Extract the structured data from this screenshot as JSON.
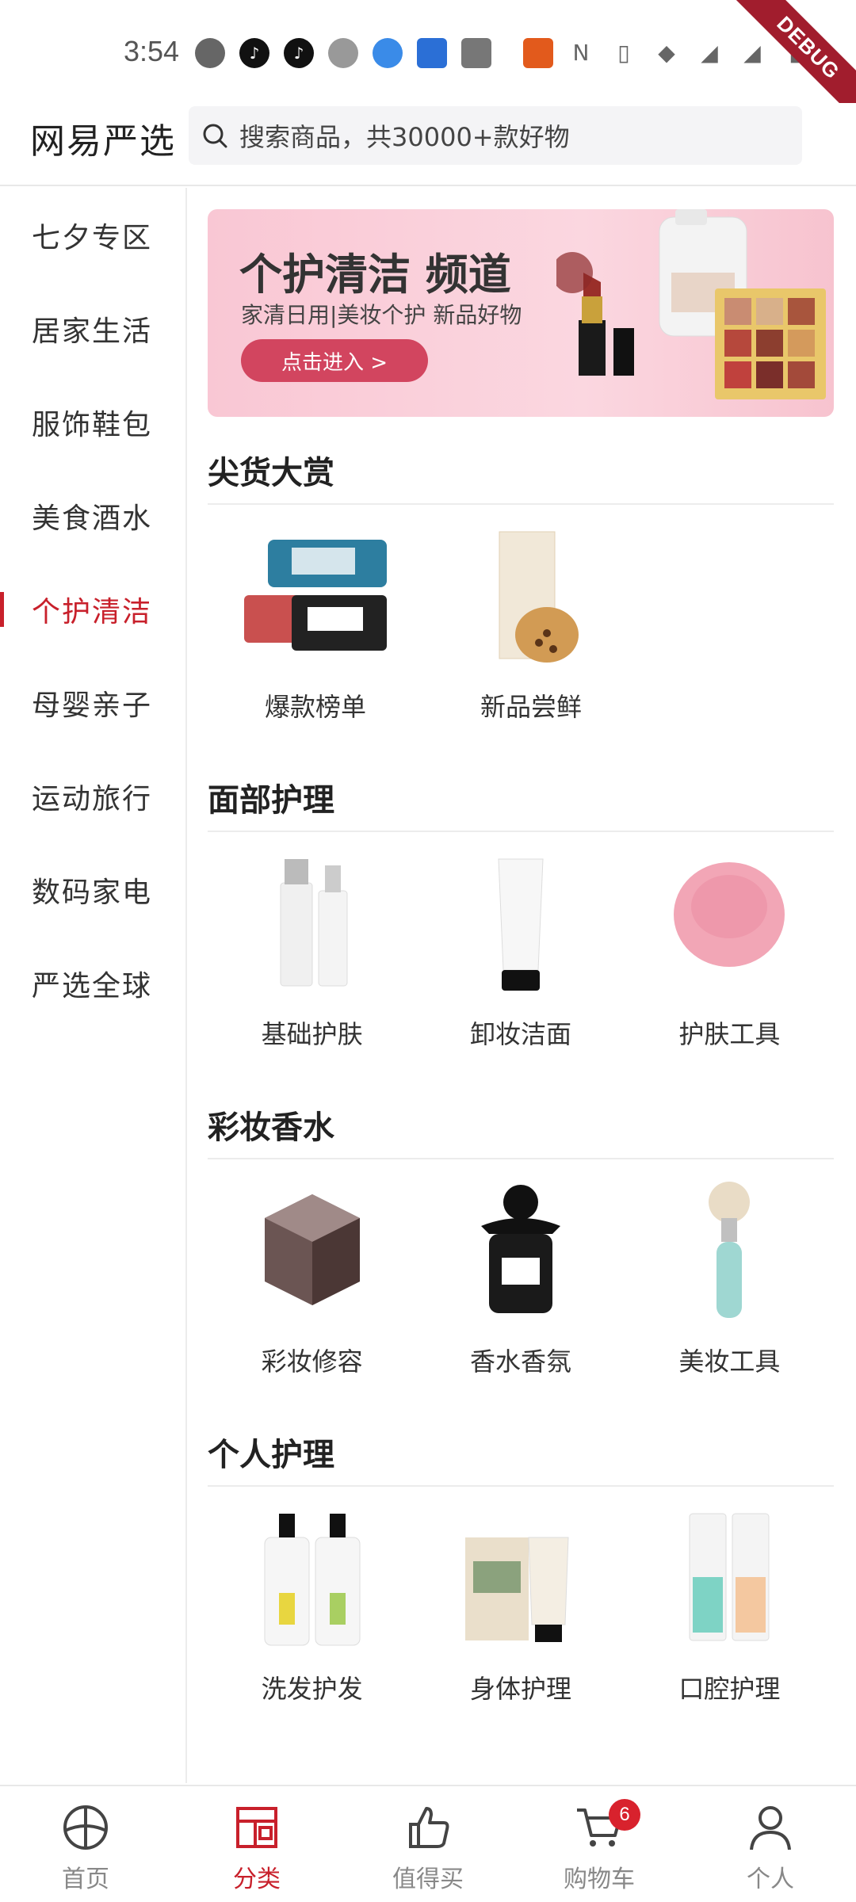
{
  "status_bar": {
    "time": "3:54",
    "debug": "DEBUG"
  },
  "header": {
    "brand": "网易严选",
    "search_placeholder": "搜索商品，共30000+款好物"
  },
  "sidebar": {
    "items": [
      {
        "label": "七夕专区"
      },
      {
        "label": "居家生活"
      },
      {
        "label": "服饰鞋包"
      },
      {
        "label": "美食酒水"
      },
      {
        "label": "个护清洁"
      },
      {
        "label": "母婴亲子"
      },
      {
        "label": "运动旅行"
      },
      {
        "label": "数码家电"
      },
      {
        "label": "严选全球"
      }
    ],
    "active_index": 4
  },
  "banner": {
    "title": "个护清洁 频道",
    "subtitle": "家清日用|美妆个护 新品好物",
    "button": "点击进入 >"
  },
  "sections": [
    {
      "title": "尖货大赏",
      "items": [
        {
          "label": "爆款榜单",
          "icon": "storage-box-icon"
        },
        {
          "label": "新品尝鲜",
          "icon": "milk-tea-product-icon"
        }
      ]
    },
    {
      "title": "面部护理",
      "items": [
        {
          "label": "基础护肤",
          "icon": "skincare-bottles-icon"
        },
        {
          "label": "卸妆洁面",
          "icon": "cleanser-tube-icon"
        },
        {
          "label": "护肤工具",
          "icon": "face-brush-icon"
        }
      ]
    },
    {
      "title": "彩妆香水",
      "items": [
        {
          "label": "彩妆修容",
          "icon": "compact-icon"
        },
        {
          "label": "香水香氛",
          "icon": "perfume-bottle-icon"
        },
        {
          "label": "美妆工具",
          "icon": "makeup-brush-icon"
        }
      ]
    },
    {
      "title": "个人护理",
      "items": [
        {
          "label": "洗发护发",
          "icon": "shampoo-bottles-icon"
        },
        {
          "label": "身体护理",
          "icon": "body-lotion-icon"
        },
        {
          "label": "口腔护理",
          "icon": "toothpaste-icon"
        }
      ]
    }
  ],
  "tabbar": {
    "items": [
      {
        "label": "首页",
        "icon": "home-icon"
      },
      {
        "label": "分类",
        "icon": "category-icon"
      },
      {
        "label": "值得买",
        "icon": "thumbs-up-icon"
      },
      {
        "label": "购物车",
        "icon": "cart-icon"
      },
      {
        "label": "个人",
        "icon": "person-icon"
      }
    ],
    "active_index": 1,
    "cart_badge": "6"
  },
  "colors": {
    "accent": "#c8202b",
    "banner_bg": "#f9c7d4"
  }
}
